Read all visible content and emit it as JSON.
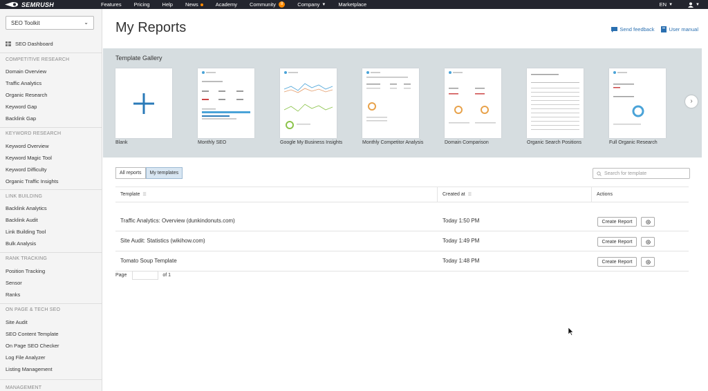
{
  "topbar": {
    "logo": "SEMRUSH",
    "nav": [
      "Features",
      "Pricing",
      "Help",
      "News",
      "Academy",
      "Community",
      "Company",
      "Marketplace"
    ],
    "community_badge": "8",
    "lang": "EN"
  },
  "sidebar": {
    "toolkit": "SEO Toolkit",
    "dashboard": "SEO Dashboard",
    "sections": [
      {
        "title": "COMPETITIVE RESEARCH",
        "items": [
          "Domain Overview",
          "Traffic Analytics",
          "Organic Research",
          "Keyword Gap",
          "Backlink Gap"
        ]
      },
      {
        "title": "KEYWORD RESEARCH",
        "items": [
          "Keyword Overview",
          "Keyword Magic Tool",
          "Keyword Difficulty",
          "Organic Traffic Insights"
        ]
      },
      {
        "title": "LINK BUILDING",
        "items": [
          "Backlink Analytics",
          "Backlink Audit",
          "Link Building Tool",
          "Bulk Analysis"
        ]
      },
      {
        "title": "RANK TRACKING",
        "items": [
          "Position Tracking",
          "Sensor",
          "Ranks"
        ]
      },
      {
        "title": "ON PAGE & TECH SEO",
        "items": [
          "Site Audit",
          "SEO Content Template",
          "On Page SEO Checker",
          "Log File Analyzer",
          "Listing Management"
        ]
      },
      {
        "title": "MANAGEMENT",
        "items": []
      }
    ]
  },
  "main": {
    "title": "My Reports",
    "send_feedback": "Send feedback",
    "user_manual": "User manual",
    "gallery_title": "Template Gallery",
    "gallery": [
      "Blank",
      "Monthly SEO",
      "Google My Business Insights",
      "Monthly Competitor Analysis",
      "Domain Comparison",
      "Organic Search Positions",
      "Full Organic Research"
    ],
    "tabs": [
      "All reports",
      "My templates"
    ],
    "search_placeholder": "Search for template",
    "table": {
      "headers": [
        "Template",
        "Created at",
        "Actions"
      ],
      "rows": [
        {
          "template": "Traffic Analytics: Overview (dunkindonuts.com)",
          "created": "Today 1:50 PM",
          "action": "Create Report"
        },
        {
          "template": "Site Audit: Statistics (wikihow.com)",
          "created": "Today 1:49 PM",
          "action": "Create Report"
        },
        {
          "template": "Tomato Soup Template",
          "created": "Today 1:48 PM",
          "action": "Create Report"
        }
      ]
    },
    "pager": {
      "page_label": "Page",
      "of_label": "of 1"
    }
  },
  "colors": {
    "accent": "#2a6fb0",
    "topbar": "#23252e",
    "gallery_bg": "#d6dde0",
    "orange": "#ff8a00"
  }
}
